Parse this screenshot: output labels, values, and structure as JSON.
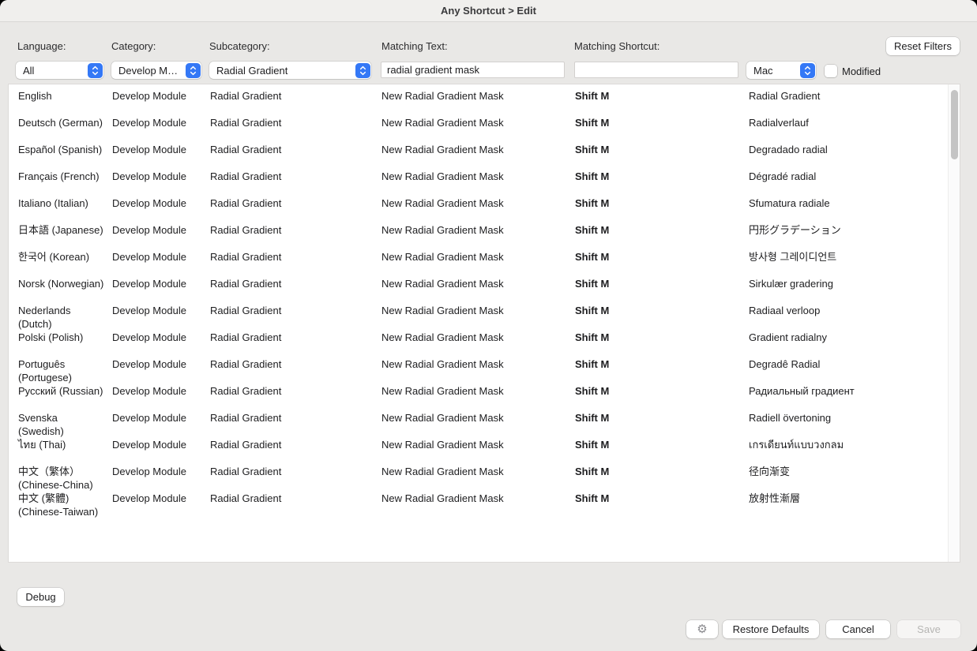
{
  "window": {
    "title": "Any Shortcut > Edit"
  },
  "filters": {
    "language": {
      "label": "Language:",
      "value": "All"
    },
    "category": {
      "label": "Category:",
      "value": "Develop Module"
    },
    "subcategory": {
      "label": "Subcategory:",
      "value": "Radial Gradient"
    },
    "matching_text": {
      "label": "Matching Text:",
      "value": "radial gradient mask"
    },
    "matching_shortcut": {
      "label": "Matching Shortcut:",
      "value": ""
    },
    "platform": {
      "value": "Mac"
    },
    "modified": {
      "label": "Modified",
      "checked": false
    },
    "reset_button": "Reset Filters"
  },
  "table": {
    "rows": [
      {
        "language": "English",
        "category": "Develop Module",
        "subcategory": "Radial Gradient",
        "matching_text": "New Radial Gradient Mask",
        "shortcut": "Shift M",
        "name": "Radial Gradient"
      },
      {
        "language": "Deutsch (German)",
        "category": "Develop Module",
        "subcategory": "Radial Gradient",
        "matching_text": "New Radial Gradient Mask",
        "shortcut": "Shift M",
        "name": "Radialverlauf"
      },
      {
        "language": "Español (Spanish)",
        "category": "Develop Module",
        "subcategory": "Radial Gradient",
        "matching_text": "New Radial Gradient Mask",
        "shortcut": "Shift M",
        "name": "Degradado radial"
      },
      {
        "language": "Français (French)",
        "category": "Develop Module",
        "subcategory": "Radial Gradient",
        "matching_text": "New Radial Gradient Mask",
        "shortcut": "Shift M",
        "name": "Dégradé radial"
      },
      {
        "language": "Italiano (Italian)",
        "category": "Develop Module",
        "subcategory": "Radial Gradient",
        "matching_text": "New Radial Gradient Mask",
        "shortcut": "Shift M",
        "name": "Sfumatura radiale"
      },
      {
        "language": "日本語 (Japanese)",
        "category": "Develop Module",
        "subcategory": "Radial Gradient",
        "matching_text": "New Radial Gradient Mask",
        "shortcut": "Shift M",
        "name": "円形グラデーション"
      },
      {
        "language": "한국어 (Korean)",
        "category": "Develop Module",
        "subcategory": "Radial Gradient",
        "matching_text": "New Radial Gradient Mask",
        "shortcut": "Shift M",
        "name": "방사형 그레이디언트"
      },
      {
        "language": "Norsk (Norwegian)",
        "category": "Develop Module",
        "subcategory": "Radial Gradient",
        "matching_text": "New Radial Gradient Mask",
        "shortcut": "Shift M",
        "name": "Sirkulær gradering"
      },
      {
        "language": "Nederlands\n(Dutch)",
        "category": "Develop Module",
        "subcategory": "Radial Gradient",
        "matching_text": "New Radial Gradient Mask",
        "shortcut": "Shift M",
        "name": "Radiaal verloop"
      },
      {
        "language": "Polski (Polish)",
        "category": "Develop Module",
        "subcategory": "Radial Gradient",
        "matching_text": "New Radial Gradient Mask",
        "shortcut": "Shift M",
        "name": "Gradient radialny"
      },
      {
        "language": "Português\n(Portugese)",
        "category": "Develop Module",
        "subcategory": "Radial Gradient",
        "matching_text": "New Radial Gradient Mask",
        "shortcut": "Shift M",
        "name": "Degradê Radial"
      },
      {
        "language": "Русский (Russian)",
        "category": "Develop Module",
        "subcategory": "Radial Gradient",
        "matching_text": "New Radial Gradient Mask",
        "shortcut": "Shift M",
        "name": "Радиальный градиент"
      },
      {
        "language": "Svenska\n(Swedish)",
        "category": "Develop Module",
        "subcategory": "Radial Gradient",
        "matching_text": "New Radial Gradient Mask",
        "shortcut": "Shift M",
        "name": "Radiell övertoning"
      },
      {
        "language": "ไทย (Thai)",
        "category": "Develop Module",
        "subcategory": "Radial Gradient",
        "matching_text": "New Radial Gradient Mask",
        "shortcut": "Shift M",
        "name": "เกรเดียนท์แบบวงกลม"
      },
      {
        "language": "中文（繁体）\n(Chinese-China)",
        "category": "Develop Module",
        "subcategory": "Radial Gradient",
        "matching_text": "New Radial Gradient Mask",
        "shortcut": "Shift M",
        "name": "径向渐变"
      },
      {
        "language": "中文 (繁體)\n(Chinese-Taiwan)",
        "category": "Develop Module",
        "subcategory": "Radial Gradient",
        "matching_text": "New Radial Gradient Mask",
        "shortcut": "Shift M",
        "name": "放射性漸層"
      }
    ]
  },
  "footer": {
    "debug_button": "Debug",
    "restore_defaults_button": "Restore Defaults",
    "cancel_button": "Cancel",
    "save_button": "Save"
  },
  "colors": {
    "accent_blue": "#3478F6"
  }
}
